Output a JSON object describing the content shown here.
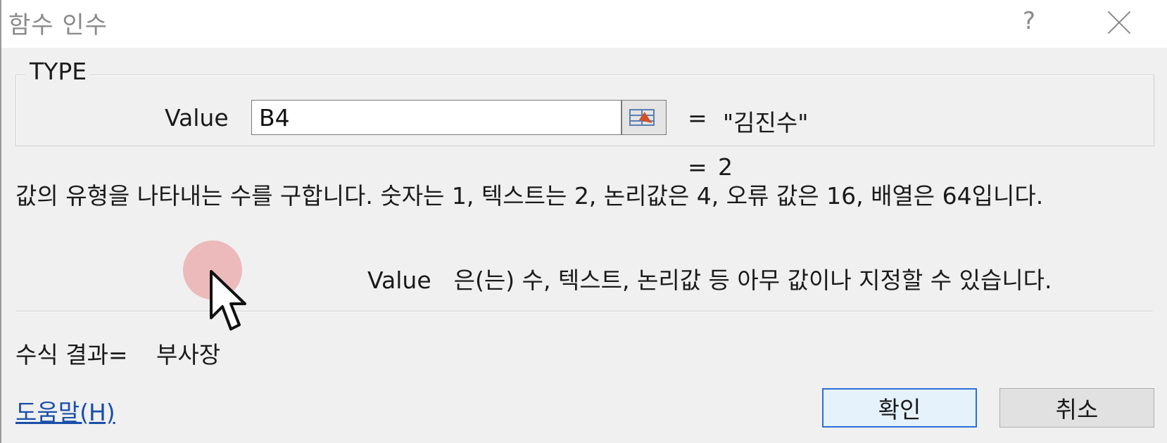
{
  "window": {
    "title": "함수 인수",
    "help_glyph": "?",
    "close_icon": "close-icon"
  },
  "function_group": {
    "name": "TYPE",
    "argument": {
      "label": "Value",
      "input_value": "B4",
      "equals": "=",
      "evaluated_value": "\"김진수\"",
      "ref_icon": "range-select-icon"
    },
    "result_equals": "=",
    "result_value": "2"
  },
  "description": "값의 유형을 나타내는 수를 구합니다. 숫자는 1, 텍스트는 2, 논리값은 4, 오류 값은 16, 배열은 64입니다.",
  "argument_description": {
    "name": "Value",
    "text": "은(는) 수, 텍스트, 논리값 등 아무 값이나 지정할 수 있습니다."
  },
  "formula_result": {
    "label": "수식 결과=",
    "value": "부사장"
  },
  "footer": {
    "help_link": "도움말(H)",
    "ok_label": "확인",
    "cancel_label": "취소"
  },
  "colors": {
    "ok_border": "#2b6fd6",
    "link": "#1a4fa8",
    "cursor_halo": "#e67878"
  }
}
